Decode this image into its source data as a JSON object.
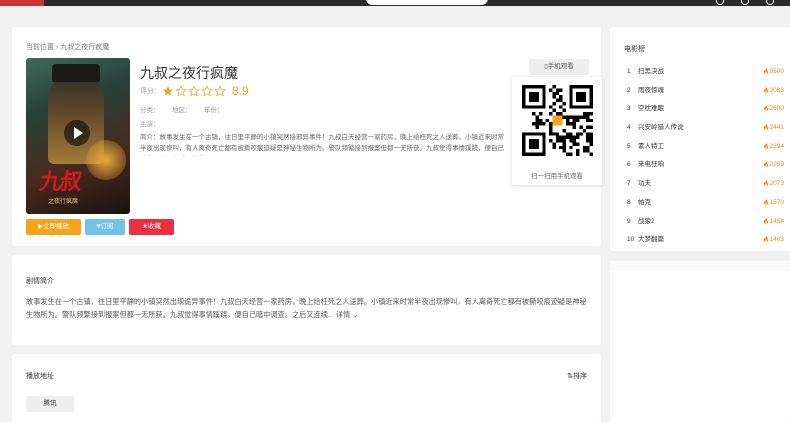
{
  "breadcrumb": "当前位置 › 九叔之夜行疯魔",
  "poster": {
    "title": "九叔",
    "subtitle": "之夜行疯魔"
  },
  "movie": {
    "title": "九叔之夜行疯魔",
    "rating_label": "评分：",
    "rating_stars": 1,
    "rating_score": "8.9",
    "meta_category": "分类：",
    "meta_area": "地区：",
    "meta_year": "年份：",
    "meta_actors": "主演：",
    "brief": "简介：故事发生在一个古镇，往日里平静的小镇突然接邪异事件！九叔白天经营一家药房，晚上给枉死之人送葬。小镇近来时常半夜出现惨叫，有人离奇死亡都有被撕咬痕迹疑是神秘生物所为。警队频繁接到报案但都一无所获。九叔觉得事情蹊跷，便自己暗中调查。之后又连续..."
  },
  "buttons": {
    "play": "▶立即播放",
    "subscribe": "♥订阅",
    "favorite": "★收藏"
  },
  "mobile": {
    "tab_label": "▯手机观看",
    "qr_caption": "扫一扫用手机观看"
  },
  "plot": {
    "title": "剧情简介",
    "text": "故事发生在一个古镇，往日里平静的小镇突然出现诡异事件！九叔白天经营一家药房，晚上给枉死之人送葬。小镇近来时常半夜出现惨叫，有人离奇死亡都有被撕咬痕迹疑是神秘生物所为。警队频繁接到报案但都一无所获。九叔觉得事情蹊跷，便自己暗中调查。之后又连续...",
    "more": "详情 ⌄"
  },
  "play_section": {
    "title": "播放地址",
    "sort": "⇅排序",
    "source": "腾讯"
  },
  "ranking": {
    "title": "电影榜",
    "items": [
      {
        "num": "1",
        "name": "扫黑决战",
        "hot": "9500"
      },
      {
        "num": "2",
        "name": "雨夜惊魂",
        "hot": "3083"
      },
      {
        "num": "3",
        "name": "空枕难眠",
        "hot": "2600"
      },
      {
        "num": "4",
        "name": "兴安岭猎人传说",
        "hot": "2441"
      },
      {
        "num": "5",
        "name": "素人特工",
        "hot": "2394"
      },
      {
        "num": "6",
        "name": "来电狂响",
        "hot": "2269"
      },
      {
        "num": "7",
        "name": "功夫",
        "hot": "2073"
      },
      {
        "num": "8",
        "name": "帕克",
        "hot": "1570"
      },
      {
        "num": "9",
        "name": "战狼2",
        "hot": "1454"
      },
      {
        "num": "10",
        "name": "大梦翻篇",
        "hot": "1403"
      }
    ]
  },
  "colors": {
    "accent": "#f7a21b",
    "subscribe": "#73c3e6",
    "favorite": "#e8313f",
    "hot": "#f28a1e"
  }
}
